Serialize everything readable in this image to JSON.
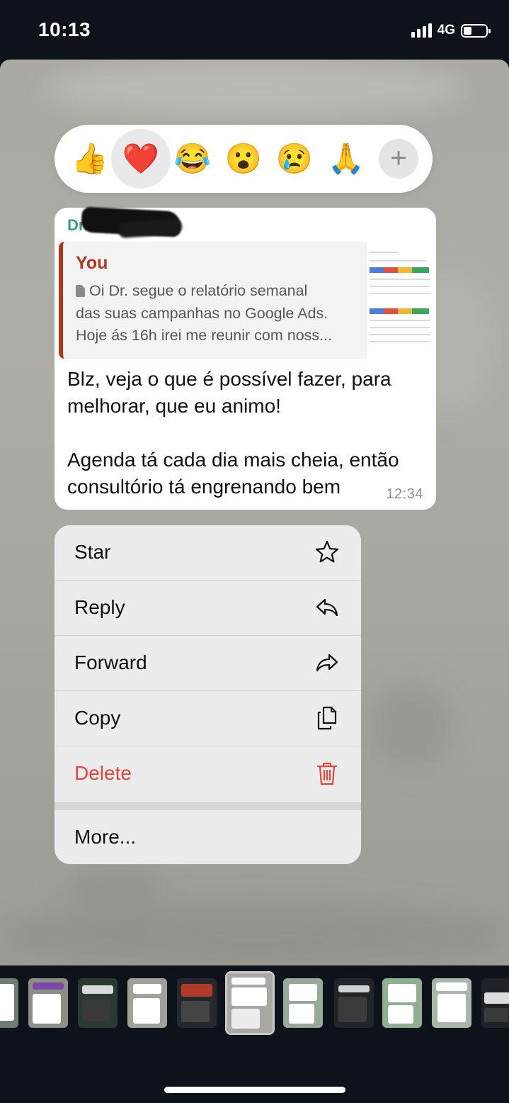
{
  "status_bar": {
    "time": "10:13",
    "network": "4G",
    "battery_level": 0.35
  },
  "reactions": {
    "items": [
      {
        "emoji": "👍",
        "name": "thumbs-up",
        "selected": false
      },
      {
        "emoji": "❤️",
        "name": "heart",
        "selected": true
      },
      {
        "emoji": "😂",
        "name": "laughing",
        "selected": false
      },
      {
        "emoji": "😮",
        "name": "surprised",
        "selected": false
      },
      {
        "emoji": "😢",
        "name": "crying",
        "selected": false
      },
      {
        "emoji": "🙏",
        "name": "praying-hands",
        "selected": false
      }
    ],
    "more_label": "+"
  },
  "message": {
    "sender": "Dr.",
    "quote": {
      "author": "You",
      "lines": [
        "Oi Dr. segue o relatório semanal",
        "das suas campanhas no Google Ads.",
        "Hoje ás 16h irei me reunir com noss..."
      ]
    },
    "text": "Blz, veja o que é possível fazer, para\nmelhorar, que eu animo!\n\nAgenda tá cada dia mais cheia, então\nconsultório tá engrenando bem",
    "time": "12:34"
  },
  "menu": {
    "items": [
      {
        "label": "Star",
        "icon": "star-icon"
      },
      {
        "label": "Reply",
        "icon": "reply-icon"
      },
      {
        "label": "Forward",
        "icon": "forward-icon"
      },
      {
        "label": "Copy",
        "icon": "copy-icon"
      },
      {
        "label": "Delete",
        "icon": "trash-icon",
        "destructive": true,
        "color": "#e5463e"
      }
    ],
    "more": "More..."
  },
  "accent_colors": {
    "quote_bar": "#b2381d",
    "sender": "#3a9c94",
    "destructive": "#e5463e"
  }
}
